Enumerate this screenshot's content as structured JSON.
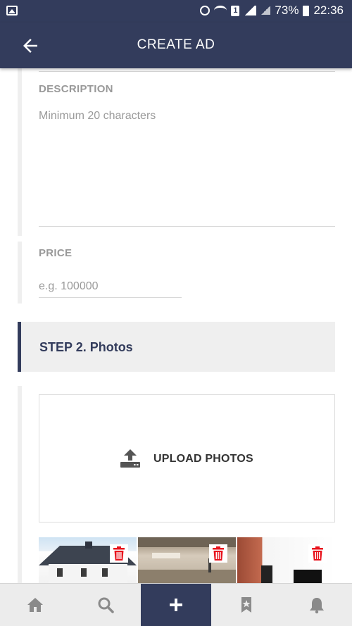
{
  "status_bar": {
    "icons": [
      "gallery-icon",
      "alarm-icon",
      "wifi-icon",
      "sim-1-icon",
      "signal-icon",
      "signal-2-icon",
      "battery-icon"
    ],
    "sim_number": "1",
    "battery": "73%",
    "time": "22:36"
  },
  "header": {
    "back_icon": "arrow-left-icon",
    "title": "CREATE AD"
  },
  "form": {
    "description": {
      "label": "DESCRIPTION",
      "placeholder": "Minimum 20 characters",
      "value": ""
    },
    "price": {
      "label": "PRICE",
      "placeholder": "e.g. 100000",
      "value": ""
    }
  },
  "step2": {
    "title": "STEP 2. Photos"
  },
  "photos": {
    "upload_label": "UPLOAD PHOTOS",
    "upload_icon": "upload-icon",
    "thumbnails": [
      {
        "name": "photo-thumbnail-1",
        "delete_icon": "trash-icon"
      },
      {
        "name": "photo-thumbnail-2",
        "delete_icon": "trash-icon"
      },
      {
        "name": "photo-thumbnail-3",
        "delete_icon": "trash-icon"
      }
    ]
  },
  "bottom_nav": {
    "items": [
      "home-icon",
      "search-icon",
      "plus-icon",
      "bookmark-star-icon",
      "bell-icon"
    ],
    "active_index": 2
  },
  "colors": {
    "primary": "#333c5c",
    "muted_text": "#999999",
    "delete_red": "#e8121c",
    "section_bg": "#efefef"
  }
}
